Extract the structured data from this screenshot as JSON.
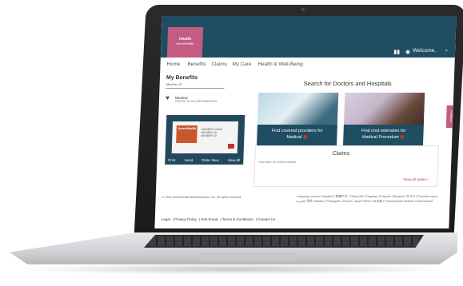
{
  "header": {
    "logo_brand": "Health",
    "logo_name": "AmeriHealth",
    "welcome": "Welcome,",
    "icons": [
      "book-icon",
      "bell-icon",
      "chevron-down-icon"
    ]
  },
  "nav": {
    "items": [
      "Home",
      "Benefits",
      "Claims",
      "My Care",
      "Health & Well-Being"
    ]
  },
  "benefits": {
    "title": "My Benefits",
    "member_id_label": "Member ID",
    "plan_type": "Medical",
    "plan_group": "GROUP PLAN INFORMATION",
    "card_text": "MEMBER NAME\nMEMBER ID\nMEMBER ID",
    "card_actions": [
      "Print",
      "Send",
      "Order New",
      "View All"
    ]
  },
  "search": {
    "title": "Search for Doctors and Hospitals",
    "tile_a_line1": "Find covered providers for",
    "tile_a_line2": "Medical",
    "tile_b_line1": "Find cost estimates for",
    "tile_b_line2": "Medical Procedure"
  },
  "claims": {
    "title": "Claims",
    "empty_text": "You have no recent claims.",
    "view_all": "View all claims"
  },
  "side_tab": "Feedback",
  "footer": {
    "copyright": "© 2021 AmeriHealth Administrators, Inc. All rights reserved.",
    "languages": "Language access: Español | 繁體中文 | Tiếng Việt | Tagalog | Français | Deutsch | 한국어 | Русский язык | العربية | हिंदी | Italiano | Português | Kreyòl | Język Polski | 日本語 | Pennsylvania Deitsch | Diné bizaad",
    "links": [
      "Legal",
      "Privacy Policy",
      "Anti-Fraud",
      "Terms & Conditions",
      "Contact Us"
    ]
  },
  "colors": {
    "primary": "#1f4e63",
    "brand_pink": "#c45b82",
    "accent_red": "#c4342b"
  }
}
